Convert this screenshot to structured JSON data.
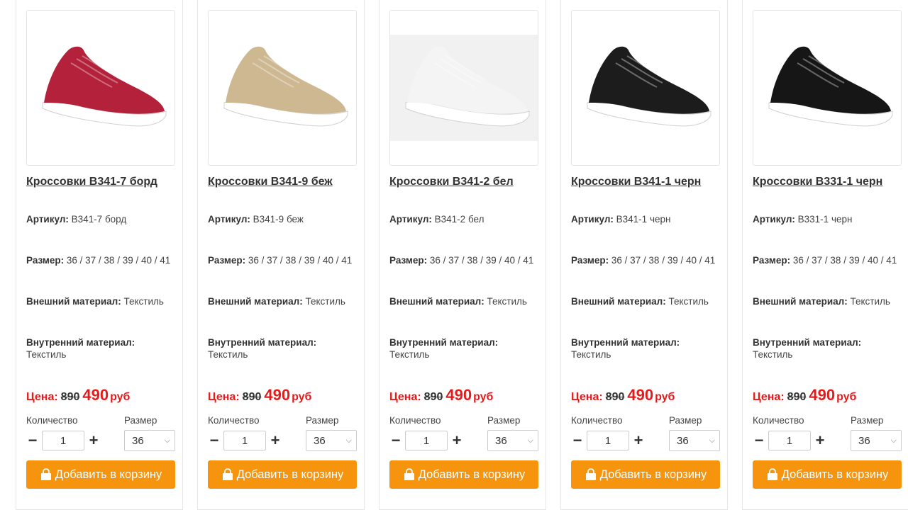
{
  "colors": {
    "accent": "#f7940d",
    "price_red": "#e31b1b"
  },
  "products": [
    {
      "title": "Кроссовки B341-7 борд",
      "article_label": "Артикул:",
      "article": "B341-7 борд",
      "size_label": "Размер:",
      "sizes": "36 / 37 / 38 / 39 / 40 / 41",
      "outer_label": "Внешний материал:",
      "outer": "Текстиль",
      "inner_label": "Внутренний материал:",
      "inner": "Текстиль",
      "price_label": "Цена:",
      "old_price": "890",
      "new_price": "490",
      "currency": "руб",
      "qty_label": "Количество",
      "qty": "1",
      "sel_size_label": "Размер",
      "sel_size": "36",
      "cart_label": "Добавить в корзину",
      "shoe_color": "#b3213a"
    },
    {
      "title": "Кроссовки B341-9 беж",
      "article_label": "Артикул:",
      "article": "B341-9 беж",
      "size_label": "Размер:",
      "sizes": "36 / 37 / 38 / 39 / 40 / 41",
      "outer_label": "Внешний материал:",
      "outer": "Текстиль",
      "inner_label": "Внутренний материал:",
      "inner": "Текстиль",
      "price_label": "Цена:",
      "old_price": "890",
      "new_price": "490",
      "currency": "руб",
      "qty_label": "Количество",
      "qty": "1",
      "sel_size_label": "Размер",
      "sel_size": "36",
      "cart_label": "Добавить в корзину",
      "shoe_color": "#cdb892"
    },
    {
      "title": "Кроссовки B341-2 бел",
      "article_label": "Артикул:",
      "article": "B341-2 бел",
      "size_label": "Размер:",
      "sizes": "36 / 37 / 38 / 39 / 40 / 41",
      "outer_label": "Внешний материал:",
      "outer": "Текстиль",
      "inner_label": "Внутренний материал:",
      "inner": "Текстиль",
      "price_label": "Цена:",
      "old_price": "890",
      "new_price": "490",
      "currency": "руб",
      "qty_label": "Количество",
      "qty": "1",
      "sel_size_label": "Размер",
      "sel_size": "36",
      "cart_label": "Добавить в корзину",
      "shoe_color": "#f4f4f4"
    },
    {
      "title": "Кроссовки B341-1 черн",
      "article_label": "Артикул:",
      "article": "B341-1 черн",
      "size_label": "Размер:",
      "sizes": "36 / 37 / 38 / 39 / 40 / 41",
      "outer_label": "Внешний материал:",
      "outer": "Текстиль",
      "inner_label": "Внутренний материал:",
      "inner": "Текстиль",
      "price_label": "Цена:",
      "old_price": "890",
      "new_price": "490",
      "currency": "руб",
      "qty_label": "Количество",
      "qty": "1",
      "sel_size_label": "Размер",
      "sel_size": "36",
      "cart_label": "Добавить в корзину",
      "shoe_color": "#1c1c1c"
    },
    {
      "title": "Кроссовки B331-1 черн",
      "article_label": "Артикул:",
      "article": "B331-1 черн",
      "size_label": "Размер:",
      "sizes": "36 / 37 / 38 / 39 / 40 / 41",
      "outer_label": "Внешний материал:",
      "outer": "Текстиль",
      "inner_label": "Внутренний материал:",
      "inner": "Текстиль",
      "price_label": "Цена:",
      "old_price": "890",
      "new_price": "490",
      "currency": "руб",
      "qty_label": "Количество",
      "qty": "1",
      "sel_size_label": "Размер",
      "sel_size": "36",
      "cart_label": "Добавить в корзину",
      "shoe_color": "#161616"
    }
  ]
}
